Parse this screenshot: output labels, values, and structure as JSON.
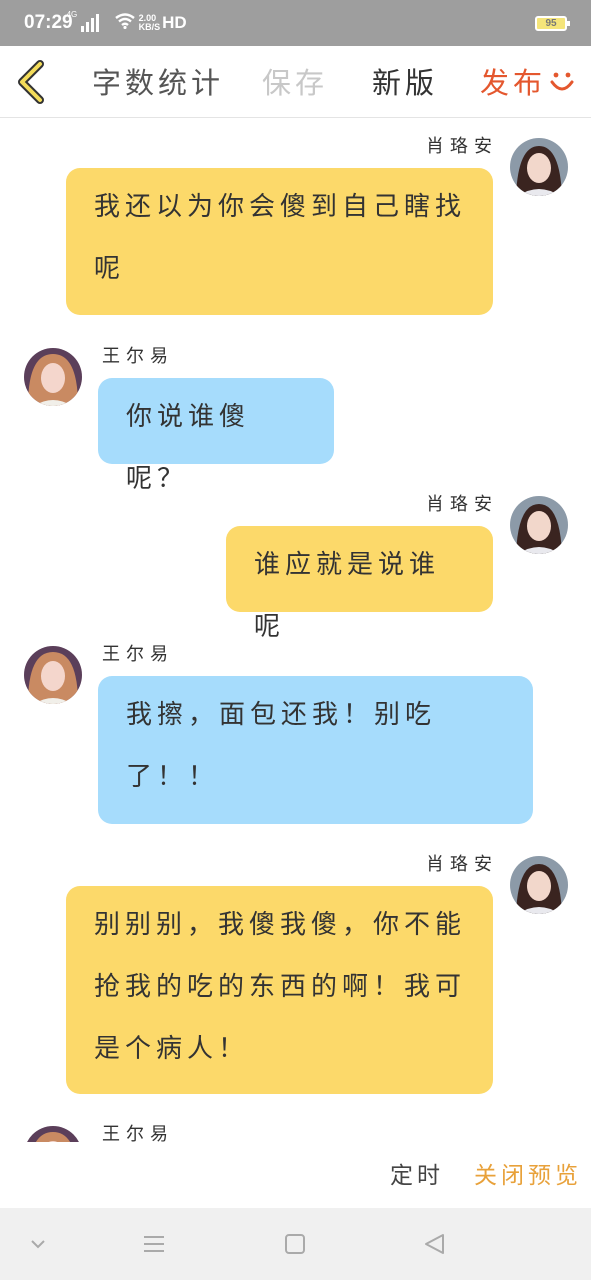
{
  "status_bar": {
    "time": "07:29",
    "network": "4G",
    "speed_value": "2.00",
    "speed_unit": "KB/S",
    "hd": "HD",
    "battery": "95"
  },
  "toolbar": {
    "back_icon": "chevron-left-icon",
    "word_count": "字数统计",
    "save": "保存",
    "new_version": "新版",
    "publish": "发布",
    "smile_icon": "smile-icon",
    "accent_color": "#e4572e"
  },
  "messages": [
    {
      "sender": "肖珞安",
      "side": "right",
      "color": "yellow",
      "text": "我还以为你会傻到自己瞎找呢"
    },
    {
      "sender": "王尔易",
      "side": "left",
      "color": "blue",
      "text": "你说谁傻呢？"
    },
    {
      "sender": "肖珞安",
      "side": "right",
      "color": "yellow",
      "text": "谁应就是说谁呢"
    },
    {
      "sender": "王尔易",
      "side": "left",
      "color": "blue",
      "text": "我擦，面包还我！别吃了！！"
    },
    {
      "sender": "肖珞安",
      "side": "right",
      "color": "yellow",
      "text": "别别别，我傻我傻，你不能抢我的吃的东西的啊！我可是个病人！"
    },
    {
      "sender": "王尔易",
      "side": "left",
      "color": "blue",
      "text": ""
    }
  ],
  "colors": {
    "yellow_bubble": "#fcd96a",
    "blue_bubble": "#a6dcfc",
    "close_preview": "#e8a13a"
  },
  "footer": {
    "timer": "定时",
    "close_preview": "关闭预览"
  },
  "nav_bar": {
    "icons": [
      "chevron-down-icon",
      "menu-icon",
      "home-square-icon",
      "back-triangle-icon"
    ]
  }
}
